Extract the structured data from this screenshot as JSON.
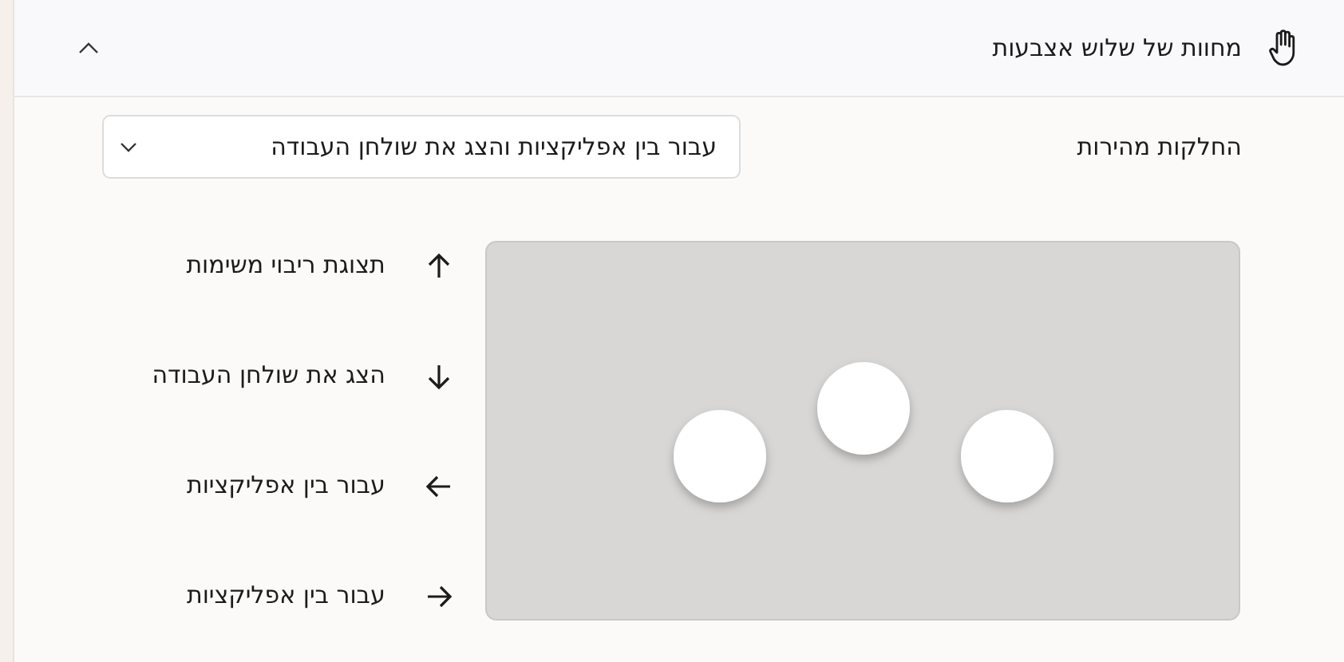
{
  "section": {
    "title": "מחוות של שלוש אצבעות",
    "expanded": true
  },
  "swipes": {
    "label": "החלקות מהירות",
    "value": "עבור בין אפליקציות והצג את שולחן העבודה"
  },
  "gestures": [
    {
      "kind": "up",
      "label": "תצוגת ריבוי משימות"
    },
    {
      "kind": "down",
      "label": "הצג את שולחן העבודה"
    },
    {
      "kind": "left",
      "label": "עבור בין אפליקציות"
    },
    {
      "kind": "right",
      "label": "עבור בין אפליקציות"
    }
  ]
}
